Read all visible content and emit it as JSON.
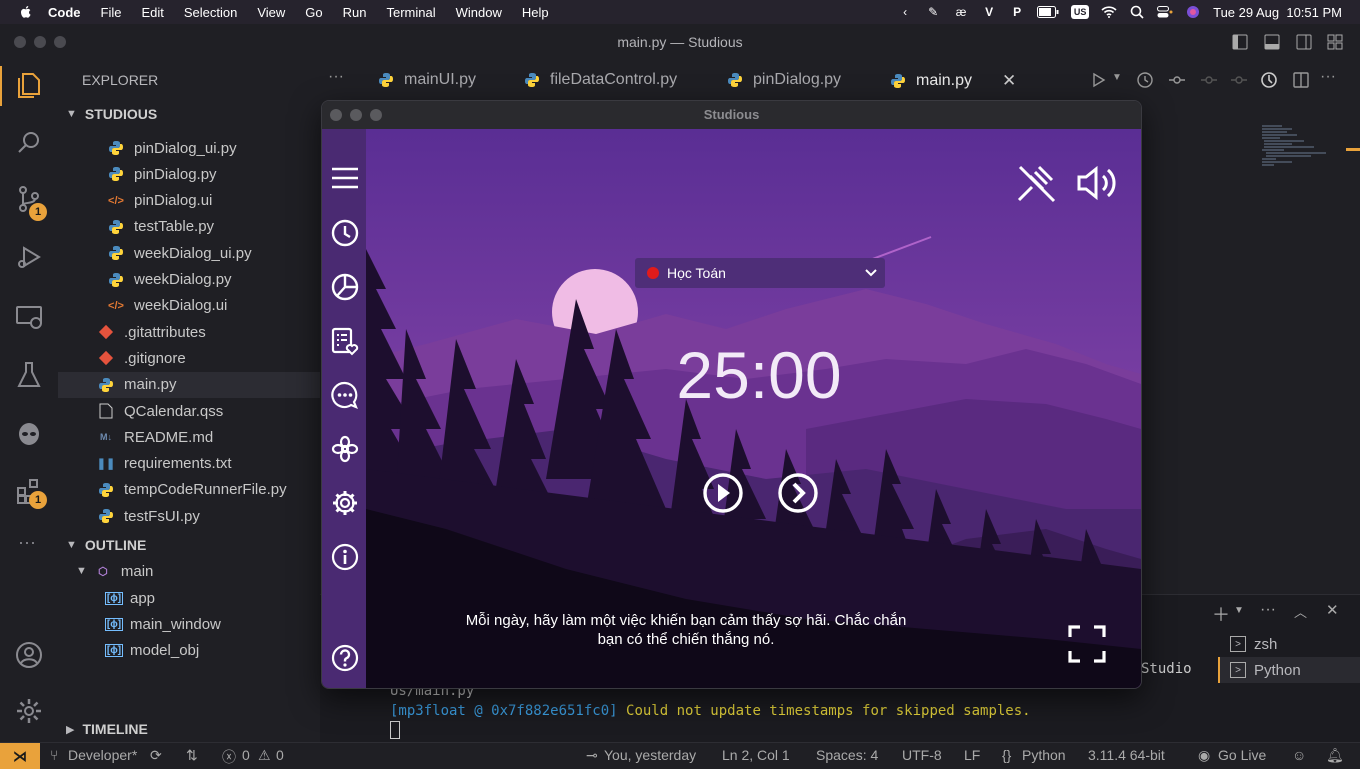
{
  "menubar": {
    "app": "Code",
    "items": [
      "File",
      "Edit",
      "Selection",
      "View",
      "Go",
      "Run",
      "Terminal",
      "Window",
      "Help"
    ],
    "clock": "Tue 29 Aug  10:51 PM",
    "input_source": "US"
  },
  "window": {
    "title": "main.py — Studious"
  },
  "activity": {
    "scm_badge": "1",
    "extensions_badge": "1"
  },
  "explorer": {
    "header": "EXPLORER",
    "project": "STUDIOUS",
    "files": [
      {
        "name": "pinDialog_ui.py",
        "type": "py"
      },
      {
        "name": "pinDialog.py",
        "type": "py"
      },
      {
        "name": "pinDialog.ui",
        "type": "ui"
      },
      {
        "name": "testTable.py",
        "type": "py"
      },
      {
        "name": "weekDialog_ui.py",
        "type": "py"
      },
      {
        "name": "weekDialog.py",
        "type": "py"
      },
      {
        "name": "weekDialog.ui",
        "type": "ui"
      },
      {
        "name": ".gitattributes",
        "type": "git"
      },
      {
        "name": ".gitignore",
        "type": "git"
      },
      {
        "name": "main.py",
        "type": "py"
      },
      {
        "name": "QCalendar.qss",
        "type": "txt"
      },
      {
        "name": "README.md",
        "type": "md"
      },
      {
        "name": "requirements.txt",
        "type": "req"
      },
      {
        "name": "tempCodeRunnerFile.py",
        "type": "py"
      },
      {
        "name": "testFsUI.py",
        "type": "py"
      }
    ],
    "outline_header": "OUTLINE",
    "outline_root": "main",
    "outline_items": [
      "app",
      "main_window",
      "model_obj"
    ],
    "timeline_header": "TIMELINE"
  },
  "tabs": [
    {
      "label": "mainUI.py"
    },
    {
      "label": "fileDataControl.py"
    },
    {
      "label": "pinDialog.py"
    },
    {
      "label": "main.py"
    }
  ],
  "terminal": {
    "line_partial": "Us/main.py",
    "log_prefix": "[mp3float @ 0x7f882e651fc0]",
    "log_message": "Could not update timestamps for skipped samples.",
    "side_label": "Studio",
    "shells": [
      "zsh",
      "Python"
    ]
  },
  "statusbar": {
    "branch": "Developer*",
    "errors": "0",
    "warnings": "0",
    "blame": "You, yesterday",
    "position": "Ln 2, Col 1",
    "spaces": "Spaces: 4",
    "encoding": "UTF-8",
    "eol": "LF",
    "language": "Python",
    "interpreter": "3.11.4 64-bit",
    "golive": "Go Live"
  },
  "studious": {
    "title": "Studious",
    "task": "Học Toán",
    "task_color": "#e11b1b",
    "timer": "25:00",
    "quote": "Mỗi ngày, hãy làm một việc khiến bạn cảm thấy sợ hãi. Chắc chắn bạn có thể chiến thắng nó.",
    "sidebar_color": "#4a2a72"
  }
}
